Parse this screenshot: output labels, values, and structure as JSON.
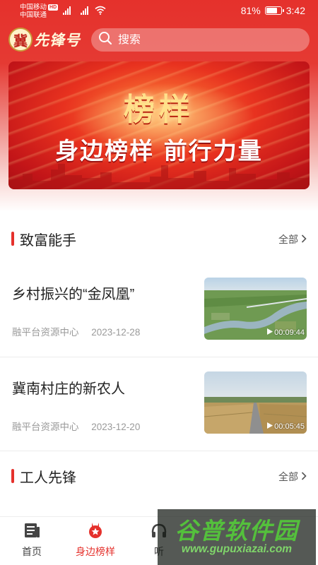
{
  "status_bar": {
    "carrier_1": "中国移动",
    "carrier_1_badge": "HD",
    "carrier_2": "中国联通",
    "battery": "81%",
    "battery_level": 0.81,
    "time": "3:42"
  },
  "header": {
    "logo_char": "冀",
    "logo_text": "先锋号",
    "search_placeholder": "搜索"
  },
  "banner": {
    "title": "榜样",
    "subtitle": "身边榜样 前行力量"
  },
  "sections": [
    {
      "title": "致富能手",
      "more_label": "全部",
      "articles": [
        {
          "title": "乡村振兴的“金凤凰”",
          "source": "融平台资源中心",
          "date": "2023-12-28",
          "duration": "00:09:44"
        },
        {
          "title": "冀南村庄的新农人",
          "source": "融平台资源中心",
          "date": "2023-12-20",
          "duration": "00:05:45"
        }
      ]
    },
    {
      "title": "工人先锋",
      "more_label": "全部"
    }
  ],
  "bottom_nav": [
    {
      "label": "首页"
    },
    {
      "label": "身边榜样"
    },
    {
      "label": "听"
    }
  ],
  "watermark": {
    "title": "谷普软件园",
    "url": "www.gupuxiazai.com"
  },
  "colors": {
    "accent": "#e5312c",
    "header_red": "#e53a33",
    "watermark_green": "#54c03c"
  }
}
